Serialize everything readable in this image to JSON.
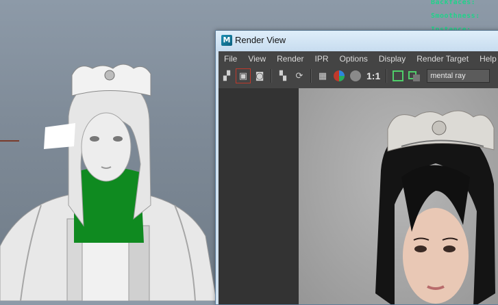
{
  "viewport": {
    "hud_labels": [
      "Backfaces:",
      "Smoothness:",
      "Instance:"
    ]
  },
  "render_view": {
    "title": "Render View",
    "app_icon": "maya-icon",
    "menu": [
      "File",
      "View",
      "Render",
      "IPR",
      "Options",
      "Display",
      "Render Target",
      "Help"
    ],
    "toolbar": {
      "icons": [
        "redo-render-icon",
        "render-region-icon",
        "snapshot-icon",
        "ipr-render-icon",
        "refresh-icon",
        "render-settings-icon",
        "color-channels-icon",
        "alpha-channel-icon",
        "frame-indicator-icon",
        "image-compare-icon"
      ],
      "ratio_label": "1:1",
      "renderer": "mental ray"
    }
  },
  "colors": {
    "hud_text": "#1fd38a",
    "panel_bg": "#444444",
    "titlebar": "#cfe0ef",
    "mesh_highlight": "#0f8a20"
  }
}
